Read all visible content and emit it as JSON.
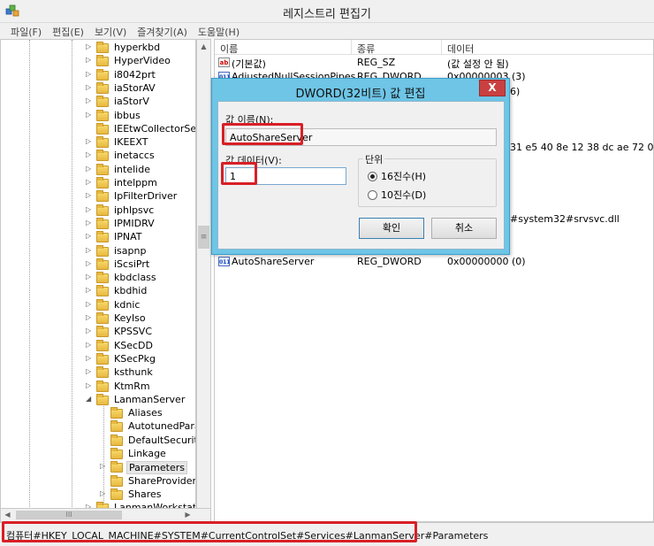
{
  "window": {
    "title": "레지스트리 편집기"
  },
  "menu": [
    "파일(F)",
    "편집(E)",
    "보기(V)",
    "즐겨찾기(A)",
    "도움말(H)"
  ],
  "tree": {
    "items": [
      {
        "label": "hyperkbd",
        "arrow": "▷"
      },
      {
        "label": "HyperVideo",
        "arrow": "▷"
      },
      {
        "label": "i8042prt",
        "arrow": "▷"
      },
      {
        "label": "iaStorAV",
        "arrow": "▷"
      },
      {
        "label": "iaStorV",
        "arrow": "▷"
      },
      {
        "label": "ibbus",
        "arrow": "▷"
      },
      {
        "label": "IEEtwCollectorService",
        "arrow": ""
      },
      {
        "label": "IKEEXT",
        "arrow": "▷"
      },
      {
        "label": "inetaccs",
        "arrow": "▷"
      },
      {
        "label": "intelide",
        "arrow": "▷"
      },
      {
        "label": "intelppm",
        "arrow": "▷"
      },
      {
        "label": "IpFilterDriver",
        "arrow": "▷"
      },
      {
        "label": "iphlpsvc",
        "arrow": "▷"
      },
      {
        "label": "IPMIDRV",
        "arrow": "▷"
      },
      {
        "label": "IPNAT",
        "arrow": "▷"
      },
      {
        "label": "isapnp",
        "arrow": "▷"
      },
      {
        "label": "iScsiPrt",
        "arrow": "▷"
      },
      {
        "label": "kbdclass",
        "arrow": "▷"
      },
      {
        "label": "kbdhid",
        "arrow": "▷"
      },
      {
        "label": "kdnic",
        "arrow": "▷"
      },
      {
        "label": "KeyIso",
        "arrow": "▷"
      },
      {
        "label": "KPSSVC",
        "arrow": "▷"
      },
      {
        "label": "KSecDD",
        "arrow": "▷"
      },
      {
        "label": "KSecPkg",
        "arrow": "▷"
      },
      {
        "label": "ksthunk",
        "arrow": "▷"
      },
      {
        "label": "KtmRm",
        "arrow": "▷"
      },
      {
        "label": "LanmanServer",
        "arrow": "◢"
      }
    ],
    "children": [
      {
        "label": "Aliases",
        "arrow": ""
      },
      {
        "label": "AutotunedParame",
        "arrow": ""
      },
      {
        "label": "DefaultSecurity",
        "arrow": ""
      },
      {
        "label": "Linkage",
        "arrow": ""
      },
      {
        "label": "Parameters",
        "arrow": "▷"
      },
      {
        "label": "ShareProviders",
        "arrow": ""
      },
      {
        "label": "Shares",
        "arrow": "▷"
      }
    ],
    "last": {
      "label": "LanmanWorkstation",
      "arrow": "▷"
    },
    "hscroll_thumb": "III",
    "vscroll_thumb": "≡"
  },
  "list": {
    "headers": {
      "name": "이름",
      "type": "종류",
      "data": "데이터"
    },
    "rows": [
      {
        "icon": "ab",
        "name": "(기본값)",
        "type": "REG_SZ",
        "data": "(값 설정 안 됨)"
      },
      {
        "icon": "011",
        "name": "AdjustedNullSessionPipes",
        "type": "REG_DWORD",
        "data": "0x00000003 (3)"
      }
    ],
    "last_row": {
      "icon": "011",
      "name": "AutoShareServer",
      "type": "REG_DWORD",
      "data": "0x00000000 (0)"
    },
    "fragments": {
      "f1": "6)",
      "f2": "31 e5 40 8e 12 38 dc ae 72 04 1f",
      "f3": "#system32#srvsvc.dll"
    }
  },
  "dialog": {
    "title": "DWORD(32비트) 값 편집",
    "close": "X",
    "value_name_label": "값 이름(N):",
    "value_name": "AutoShareServer",
    "value_data_label": "값 데이터(V):",
    "value_data": "1",
    "base_label": "단위",
    "hex_label": "16진수(H)",
    "dec_label": "10진수(D)",
    "ok": "확인",
    "cancel": "취소"
  },
  "status": {
    "path": "컴퓨터#HKEY_LOCAL_MACHINE#SYSTEM#CurrentControlSet#Services#LanmanServer#Parameters"
  },
  "colors": {
    "dialog_frame": "#6ec5e6",
    "highlight": "#d91f26",
    "close_button": "#c94040"
  }
}
